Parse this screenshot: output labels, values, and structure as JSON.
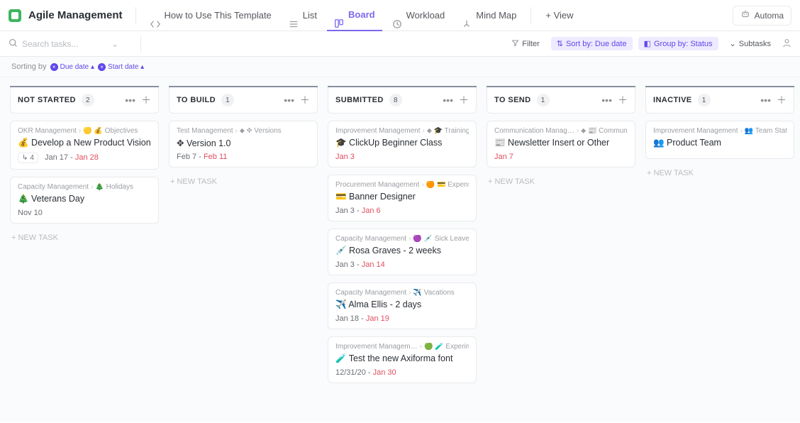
{
  "app": {
    "title": "Agile Management"
  },
  "views": {
    "howto": "How to Use This Template",
    "list": "List",
    "board": "Board",
    "workload": "Workload",
    "mindmap": "Mind Map",
    "add": "+ View",
    "automations": "Automa"
  },
  "search": {
    "placeholder": "Search tasks..."
  },
  "toolbar": {
    "filter": "Filter",
    "sort": "Sort by: Due date",
    "group": "Group by: Status",
    "subtasks": "Subtasks"
  },
  "sorting": {
    "label": "Sorting by",
    "pills": [
      "Due date ▴",
      "Start date ▴"
    ]
  },
  "new_task_label": "+ NEW TASK",
  "columns": [
    {
      "name": "NOT STARTED",
      "count": "2",
      "cards": [
        {
          "crumb1": "OKR Management",
          "crumb2": "🟡 💰 Objectives",
          "title": "💰 Develop a New Product Vision",
          "subtasks": "4",
          "start": "Jan 17",
          "due": "Jan 28"
        },
        {
          "crumb1": "Capacity Management",
          "crumb2": "🎄 Holidays",
          "title": "🎄 Veterans Day",
          "start": "Nov 10",
          "due": ""
        }
      ]
    },
    {
      "name": "TO BUILD",
      "count": "1",
      "cards": [
        {
          "crumb1": "Test Management",
          "crumb2": "⬥ ✥ Versions",
          "title": "✥ Version 1.0",
          "start": "Feb 7",
          "due": "Feb 11"
        }
      ]
    },
    {
      "name": "SUBMITTED",
      "count": "8",
      "cards": [
        {
          "crumb1": "Improvement Management",
          "crumb2": "⬥ 🎓 Trainings",
          "title": "🎓 ClickUp Beginner Class",
          "start": "",
          "due": "Jan 3"
        },
        {
          "crumb1": "Procurement Management",
          "crumb2": "🟠 💳 Expenses",
          "title": "💳 Banner Designer",
          "start": "Jan 3",
          "due": "Jan 6"
        },
        {
          "crumb1": "Capacity Management",
          "crumb2": "🟣 💉 Sick Leave",
          "title": "💉 Rosa Graves - 2 weeks",
          "start": "Jan 3",
          "due": "Jan 14"
        },
        {
          "crumb1": "Capacity Management",
          "crumb2": "✈️ Vacations",
          "title": "✈️ Alma Ellis - 2 days",
          "start": "Jan 18",
          "due": "Jan 19"
        },
        {
          "crumb1": "Improvement Managem…",
          "crumb2": "🟢 🧪 Experime…",
          "title": "🧪 Test the new Axiforma font",
          "start": "12/31/20",
          "due": "Jan 30"
        }
      ]
    },
    {
      "name": "TO SEND",
      "count": "1",
      "cards": [
        {
          "crumb1": "Communication Manag…",
          "crumb2": "⬥ 📰 Communica…",
          "title": "📰 Newsletter Insert or Other",
          "start": "",
          "due": "Jan 7"
        }
      ]
    },
    {
      "name": "INACTIVE",
      "count": "1",
      "cards": [
        {
          "crumb1": "Improvement Management",
          "crumb2": "👥 Team Status",
          "title": "👥 Product Team",
          "start": "",
          "due": ""
        }
      ]
    }
  ]
}
